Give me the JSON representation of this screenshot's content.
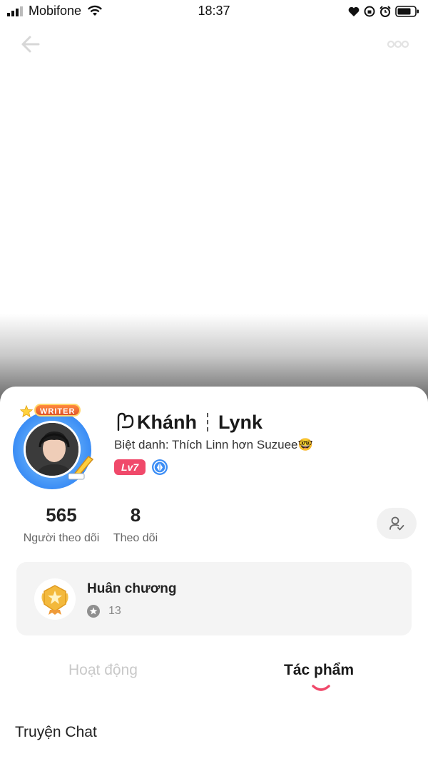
{
  "status_bar": {
    "carrier": "Mobifone",
    "time": "18:37"
  },
  "profile": {
    "avatar_badge": "WRITER",
    "name_first": "Khánh",
    "name_second": "Lynk",
    "nickname": "Biệt danh: Thích Linn hơn Suzuee🤓",
    "level": "Lv7"
  },
  "stats": {
    "followers_value": "565",
    "followers_label": "Người theo dõi",
    "following_value": "8",
    "following_label": "Theo dõi"
  },
  "medals": {
    "title": "Huân chương",
    "count": "13"
  },
  "tabs": {
    "activity": "Hoạt động",
    "works": "Tác phẩm"
  },
  "section": {
    "title": "Truyện Chat"
  },
  "colors": {
    "accent": "#f0496a",
    "verify": "#3b8df5"
  }
}
